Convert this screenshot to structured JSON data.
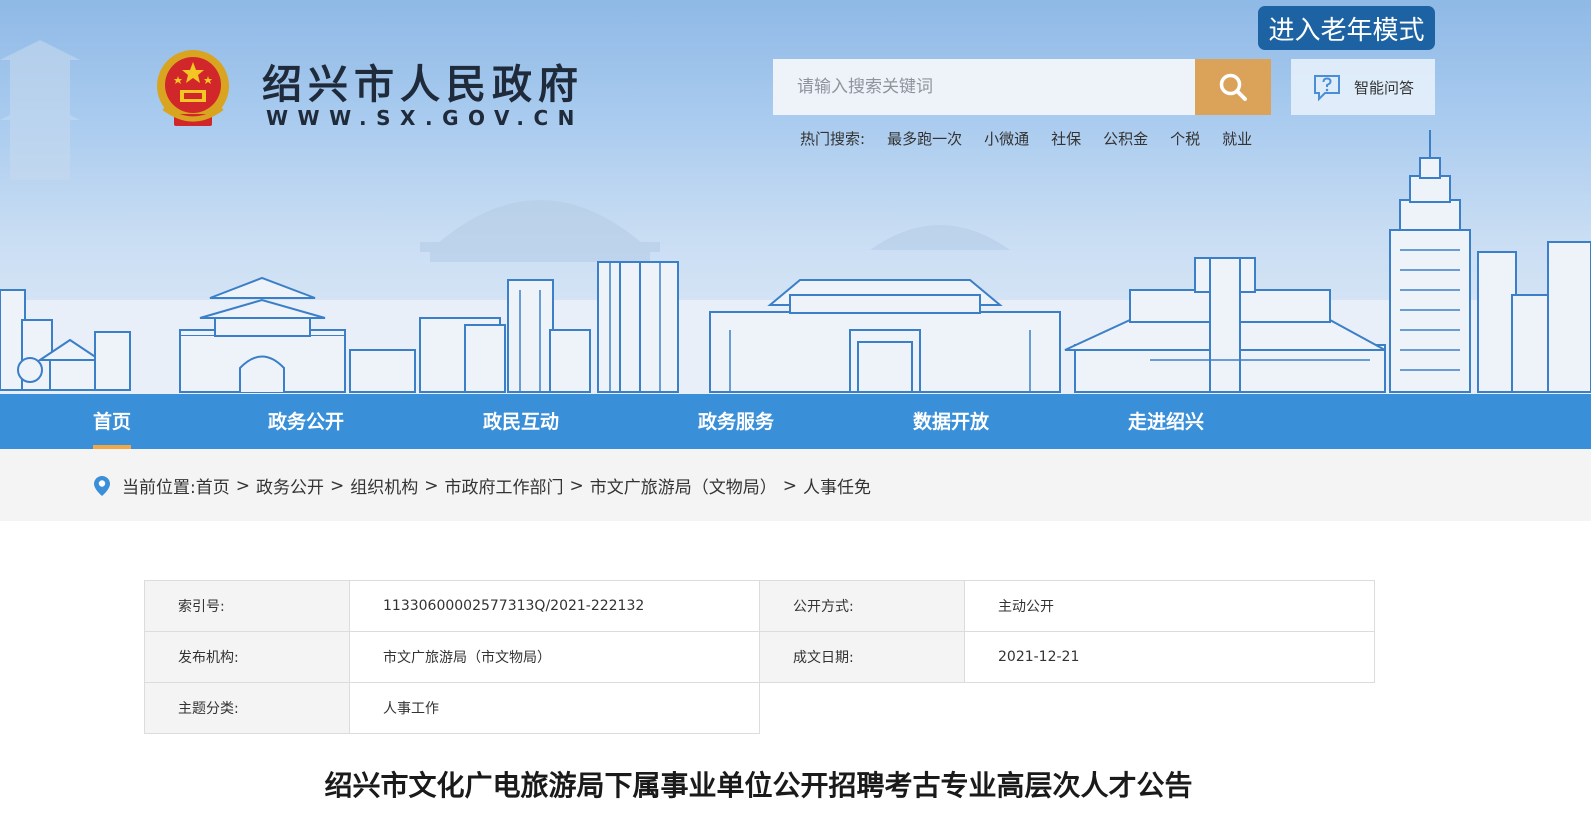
{
  "header": {
    "site_name": "绍兴市人民政府",
    "site_url": "WWW.SX.GOV.CN",
    "elder_mode_label": "进入老年模式",
    "search": {
      "placeholder": "请输入搜索关键词"
    },
    "ai_qa_label": "智能问答",
    "hot_search": {
      "label": "热门搜索:",
      "items": [
        "最多跑一次",
        "小微通",
        "社保",
        "公积金",
        "个税",
        "就业"
      ]
    }
  },
  "nav": {
    "items": [
      {
        "label": "首页",
        "active": true
      },
      {
        "label": "政务公开",
        "active": false
      },
      {
        "label": "政民互动",
        "active": false
      },
      {
        "label": "政务服务",
        "active": false
      },
      {
        "label": "数据开放",
        "active": false
      },
      {
        "label": "走进绍兴",
        "active": false
      }
    ]
  },
  "breadcrumb": {
    "prefix": "当前位置:",
    "separator": ">",
    "items": [
      "首页",
      "政务公开",
      "组织机构",
      "市政府工作部门",
      "市文广旅游局（文物局）",
      "人事任免"
    ]
  },
  "info": {
    "index_label": "索引号:",
    "index_value": "11330600002577313Q/2021-222132",
    "open_mode_label": "公开方式:",
    "open_mode_value": "主动公开",
    "publisher_label": "发布机构:",
    "publisher_value": "市文广旅游局（市文物局）",
    "date_label": "成文日期:",
    "date_value": "2021-12-21",
    "topic_label": "主题分类:",
    "topic_value": "人事工作"
  },
  "article": {
    "title": "绍兴市文化广电旅游局下属事业单位公开招聘考古专业高层次人才公告"
  },
  "colors": {
    "nav_bg": "#3a8fd9",
    "nav_active_underline": "#f0a748",
    "search_button": "#dba25a",
    "elder_button": "#1d63a3",
    "location_pin": "#3a8fd9"
  }
}
